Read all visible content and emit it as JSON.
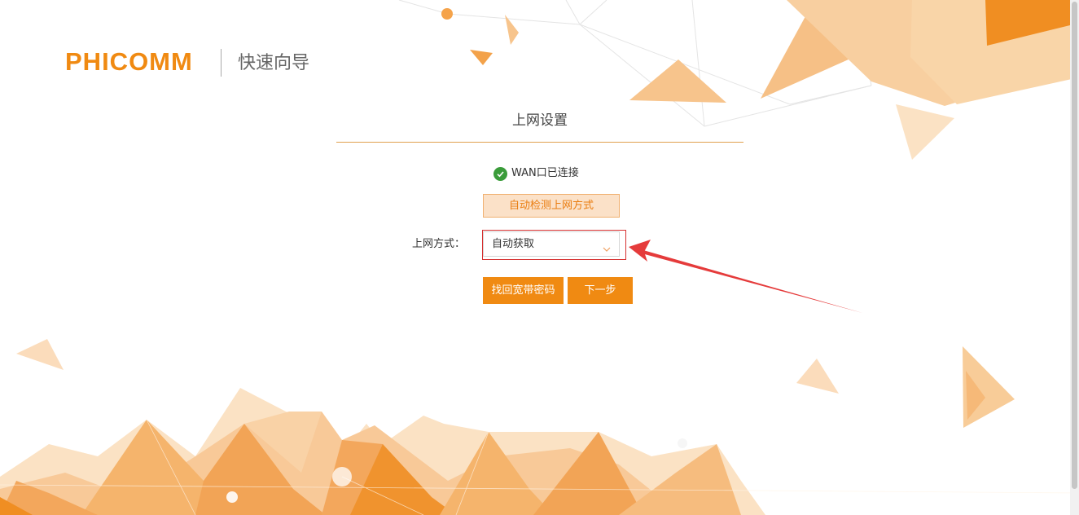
{
  "brand": {
    "logo_text": "PHICOMM",
    "guide_title": "快速向导"
  },
  "section": {
    "title": "上网设置"
  },
  "wan_status": {
    "text": "WAN口已连接",
    "icon": "check-circle-icon",
    "color": "#3a9c3a"
  },
  "detect_button": {
    "label": "自动检测上网方式"
  },
  "connection_mode": {
    "label": "上网方式：",
    "selected": "自动获取"
  },
  "actions": {
    "recover_password_label": "找回宽带密码",
    "next_label": "下一步"
  },
  "colors": {
    "accent": "#f08a12",
    "accent_light": "#fbe1c8",
    "annotation_red": "#d62f2f"
  }
}
